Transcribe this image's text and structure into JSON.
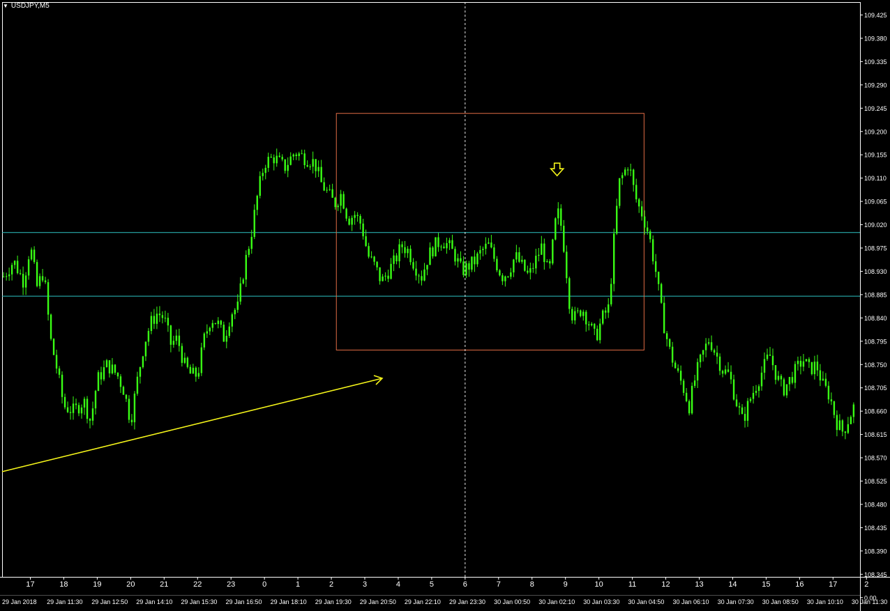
{
  "window": {
    "title": "USDJPY,M5"
  },
  "colors": {
    "background": "#000000",
    "candle": "#39ff14",
    "frame": "#ffffff",
    "level_line": "#2ec4c4",
    "box": "#e06c45",
    "trend_arrow": "#f5f51a",
    "marker_arrow": "#f5f51a",
    "crosshair": "#ffffff"
  },
  "chart_data": {
    "type": "candlestick",
    "symbol": "USDJPY",
    "timeframe": "M5",
    "y_ticks": [
      "109.425",
      "109.380",
      "109.335",
      "109.290",
      "109.245",
      "109.200",
      "109.155",
      "109.110",
      "109.065",
      "109.020",
      "108.975",
      "108.930",
      "108.885",
      "108.840",
      "108.795",
      "108.750",
      "108.705",
      "108.660",
      "108.615",
      "108.570",
      "108.525",
      "108.480",
      "108.435",
      "108.390",
      "108.345",
      "0.00"
    ],
    "ylim": [
      108.33,
      109.43
    ],
    "hour_ticks": [
      "17",
      "18",
      "19",
      "20",
      "21",
      "22",
      "23",
      "0",
      "1",
      "2",
      "3",
      "4",
      "5",
      "6",
      "7",
      "8",
      "9",
      "10",
      "11",
      "12",
      "13",
      "14",
      "15",
      "16",
      "17",
      "2"
    ],
    "date_ticks": [
      "29 Jan 2018",
      "29 Jan 11:30",
      "29 Jan 12:50",
      "29 Jan 14:10",
      "29 Jan 15:30",
      "29 Jan 16:50",
      "29 Jan 18:10",
      "29 Jan 19:30",
      "29 Jan 20:50",
      "29 Jan 22:10",
      "29 Jan 23:30",
      "30 Jan 00:50",
      "30 Jan 02:10",
      "30 Jan 03:30",
      "30 Jan 04:50",
      "30 Jan 06:10",
      "30 Jan 07:30",
      "30 Jan 08:50",
      "30 Jan 10:10",
      "30 Jan 11:30"
    ],
    "horizontal_levels": [
      109.005,
      108.882
    ],
    "range_box": {
      "price_top": 109.235,
      "price_bottom": 108.778,
      "hour_from": 2.15,
      "hour_to": 11.35
    },
    "marker": {
      "hour": 8.75,
      "price": 109.12,
      "shape": "down-arrow"
    },
    "crosshair_hour": 6,
    "price_path": [
      {
        "h": -7.8,
        "p": 108.92
      },
      {
        "h": -7.5,
        "p": 108.95
      },
      {
        "h": -7.2,
        "p": 108.91
      },
      {
        "h": -7.0,
        "p": 108.98
      },
      {
        "h": -6.8,
        "p": 108.9
      },
      {
        "h": -6.6,
        "p": 108.93
      },
      {
        "h": -6.4,
        "p": 108.8
      },
      {
        "h": -6.2,
        "p": 108.74
      },
      {
        "h": -6.0,
        "p": 108.67
      },
      {
        "h": -5.7,
        "p": 108.66
      },
      {
        "h": -5.4,
        "p": 108.68
      },
      {
        "h": -5.2,
        "p": 108.64
      },
      {
        "h": -5.0,
        "p": 108.72
      },
      {
        "h": -4.7,
        "p": 108.75
      },
      {
        "h": -4.4,
        "p": 108.73
      },
      {
        "h": -4.2,
        "p": 108.7
      },
      {
        "h": -4.0,
        "p": 108.64
      },
      {
        "h": -3.8,
        "p": 108.72
      },
      {
        "h": -3.6,
        "p": 108.79
      },
      {
        "h": -3.4,
        "p": 108.83
      },
      {
        "h": -3.2,
        "p": 108.85
      },
      {
        "h": -3.0,
        "p": 108.84
      },
      {
        "h": -2.8,
        "p": 108.79
      },
      {
        "h": -2.6,
        "p": 108.8
      },
      {
        "h": -2.4,
        "p": 108.75
      },
      {
        "h": -2.2,
        "p": 108.73
      },
      {
        "h": -2.0,
        "p": 108.73
      },
      {
        "h": -1.8,
        "p": 108.8
      },
      {
        "h": -1.6,
        "p": 108.84
      },
      {
        "h": -1.4,
        "p": 108.83
      },
      {
        "h": -1.2,
        "p": 108.8
      },
      {
        "h": -1.0,
        "p": 108.85
      },
      {
        "h": -0.8,
        "p": 108.86
      },
      {
        "h": -0.6,
        "p": 108.94
      },
      {
        "h": -0.4,
        "p": 109.0
      },
      {
        "h": -0.2,
        "p": 109.08
      },
      {
        "h": 0.0,
        "p": 109.14
      },
      {
        "h": 0.3,
        "p": 109.15
      },
      {
        "h": 0.6,
        "p": 109.13
      },
      {
        "h": 0.9,
        "p": 109.16
      },
      {
        "h": 1.2,
        "p": 109.15
      },
      {
        "h": 1.5,
        "p": 109.14
      },
      {
        "h": 1.7,
        "p": 109.1
      },
      {
        "h": 1.9,
        "p": 109.08
      },
      {
        "h": 2.1,
        "p": 109.06
      },
      {
        "h": 2.3,
        "p": 109.08
      },
      {
        "h": 2.5,
        "p": 109.03
      },
      {
        "h": 2.7,
        "p": 109.04
      },
      {
        "h": 2.9,
        "p": 109.02
      },
      {
        "h": 3.1,
        "p": 108.96
      },
      {
        "h": 3.3,
        "p": 108.94
      },
      {
        "h": 3.5,
        "p": 108.91
      },
      {
        "h": 3.7,
        "p": 108.93
      },
      {
        "h": 3.9,
        "p": 108.95
      },
      {
        "h": 4.1,
        "p": 108.98
      },
      {
        "h": 4.3,
        "p": 108.97
      },
      {
        "h": 4.5,
        "p": 108.94
      },
      {
        "h": 4.7,
        "p": 108.92
      },
      {
        "h": 4.9,
        "p": 108.96
      },
      {
        "h": 5.1,
        "p": 108.98
      },
      {
        "h": 5.3,
        "p": 108.99
      },
      {
        "h": 5.5,
        "p": 108.98
      },
      {
        "h": 5.7,
        "p": 108.96
      },
      {
        "h": 5.9,
        "p": 108.93
      },
      {
        "h": 6.1,
        "p": 108.94
      },
      {
        "h": 6.3,
        "p": 108.95
      },
      {
        "h": 6.5,
        "p": 108.97
      },
      {
        "h": 6.7,
        "p": 108.98
      },
      {
        "h": 6.9,
        "p": 108.95
      },
      {
        "h": 7.1,
        "p": 108.92
      },
      {
        "h": 7.3,
        "p": 108.93
      },
      {
        "h": 7.5,
        "p": 108.96
      },
      {
        "h": 7.7,
        "p": 108.94
      },
      {
        "h": 7.9,
        "p": 108.92
      },
      {
        "h": 8.1,
        "p": 108.95
      },
      {
        "h": 8.3,
        "p": 108.98
      },
      {
        "h": 8.5,
        "p": 108.92
      },
      {
        "h": 8.6,
        "p": 108.97
      },
      {
        "h": 8.75,
        "p": 109.05
      },
      {
        "h": 8.9,
        "p": 109.01
      },
      {
        "h": 9.0,
        "p": 108.95
      },
      {
        "h": 9.15,
        "p": 108.85
      },
      {
        "h": 9.3,
        "p": 108.84
      },
      {
        "h": 9.5,
        "p": 108.86
      },
      {
        "h": 9.7,
        "p": 108.83
      },
      {
        "h": 9.9,
        "p": 108.8
      },
      {
        "h": 10.1,
        "p": 108.84
      },
      {
        "h": 10.3,
        "p": 108.86
      },
      {
        "h": 10.45,
        "p": 108.99
      },
      {
        "h": 10.6,
        "p": 109.1
      },
      {
        "h": 10.75,
        "p": 109.12
      },
      {
        "h": 10.9,
        "p": 109.14
      },
      {
        "h": 11.0,
        "p": 109.1
      },
      {
        "h": 11.15,
        "p": 109.06
      },
      {
        "h": 11.3,
        "p": 109.04
      },
      {
        "h": 11.5,
        "p": 109.0
      },
      {
        "h": 11.7,
        "p": 108.93
      },
      {
        "h": 11.9,
        "p": 108.84
      },
      {
        "h": 12.1,
        "p": 108.78
      },
      {
        "h": 12.3,
        "p": 108.74
      },
      {
        "h": 12.5,
        "p": 108.71
      },
      {
        "h": 12.7,
        "p": 108.67
      },
      {
        "h": 12.9,
        "p": 108.73
      },
      {
        "h": 13.1,
        "p": 108.77
      },
      {
        "h": 13.3,
        "p": 108.8
      },
      {
        "h": 13.5,
        "p": 108.77
      },
      {
        "h": 13.7,
        "p": 108.74
      },
      {
        "h": 13.9,
        "p": 108.73
      },
      {
        "h": 14.1,
        "p": 108.68
      },
      {
        "h": 14.3,
        "p": 108.64
      },
      {
        "h": 14.5,
        "p": 108.68
      },
      {
        "h": 14.7,
        "p": 108.71
      },
      {
        "h": 14.9,
        "p": 108.74
      },
      {
        "h": 15.1,
        "p": 108.77
      },
      {
        "h": 15.3,
        "p": 108.73
      },
      {
        "h": 15.5,
        "p": 108.7
      },
      {
        "h": 15.7,
        "p": 108.72
      },
      {
        "h": 15.9,
        "p": 108.74
      },
      {
        "h": 16.1,
        "p": 108.76
      },
      {
        "h": 16.3,
        "p": 108.74
      },
      {
        "h": 16.5,
        "p": 108.75
      },
      {
        "h": 16.7,
        "p": 108.71
      },
      {
        "h": 16.9,
        "p": 108.69
      },
      {
        "h": 17.1,
        "p": 108.64
      },
      {
        "h": 17.3,
        "p": 108.62
      },
      {
        "h": 17.5,
        "p": 108.65
      },
      {
        "h": 17.7,
        "p": 108.68
      }
    ]
  }
}
